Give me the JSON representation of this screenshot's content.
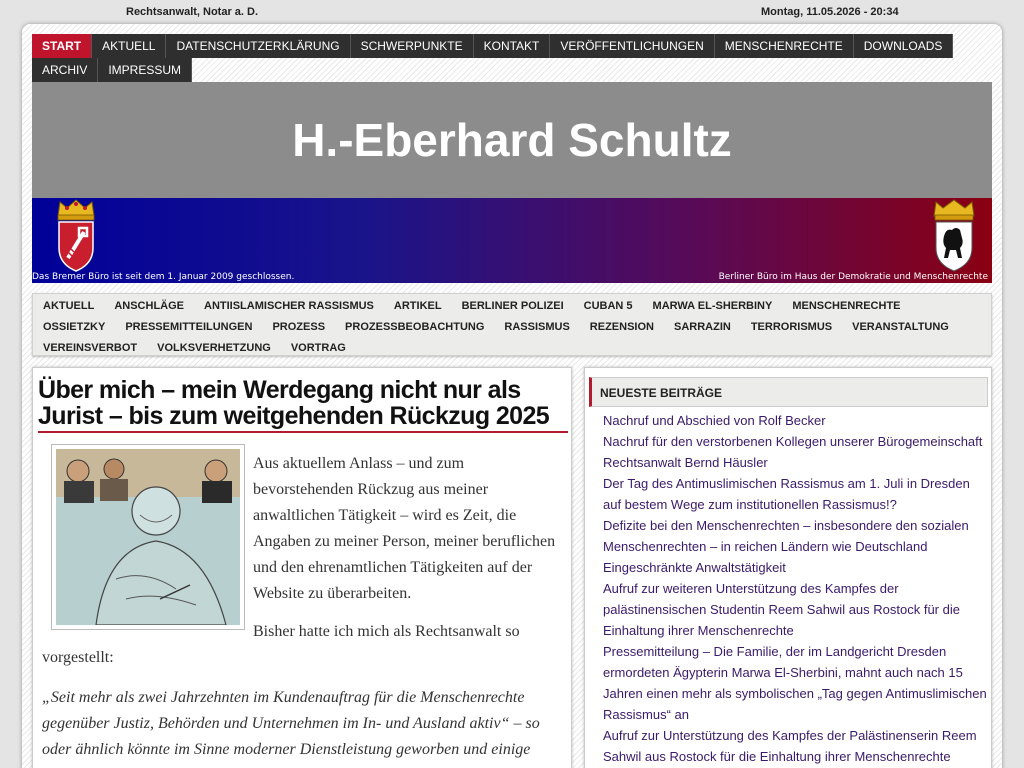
{
  "topbar": {
    "left_text": "Rechtsanwalt, Notar a. D.",
    "right_text": "Montag, 11.05.2026 - 20:34"
  },
  "main_nav": {
    "items": [
      {
        "label": "START",
        "active": true
      },
      {
        "label": "AKTUELL"
      },
      {
        "label": "DATENSCHUTZERKLÄRUNG"
      },
      {
        "label": "SCHWERPUNKTE"
      },
      {
        "label": "KONTAKT"
      },
      {
        "label": "VERÖFFENTLICHUNGEN"
      },
      {
        "label": "MENSCHENRECHTE"
      },
      {
        "label": "DOWNLOADS"
      },
      {
        "label": "ARCHIV"
      },
      {
        "label": "IMPRESSUM"
      }
    ]
  },
  "header": {
    "title": "H.-Eberhard Schultz"
  },
  "banner": {
    "left_caption": "Das Bremer Büro ist seit dem 1. Januar 2009 geschlossen.",
    "right_caption": "Berliner Büro im Haus der Demokratie und Menschenrechte",
    "left_icon": "bremen-crest-icon",
    "right_icon": "berlin-crest-icon"
  },
  "category_nav": {
    "items": [
      "AKTUELL",
      "ANSCHLÄGE",
      "ANTIISLAMISCHER RASSISMUS",
      "ARTIKEL",
      "BERLINER POLIZEI",
      "CUBAN 5",
      "MARWA EL-SHERBINY",
      "MENSCHENRECHTE",
      "OSSIETZKY",
      "PRESSEMITTEILUNGEN",
      "PROZESS",
      "PROZESSBEOBACHTUNG",
      "RASSISMUS",
      "REZENSION",
      "SARRAZIN",
      "TERRORISMUS",
      "VERANSTALTUNG",
      "VEREINSVERBOT",
      "VOLKSVERHETZUNG",
      "VORTRAG"
    ]
  },
  "article": {
    "title": "Über mich – mein Werdegang nicht nur als Jurist – bis zum weitgehenden Rückzug 2025",
    "paragraph1": "Aus aktuellem Anlass – und zum bevorstehenden Rückzug aus meiner anwaltlichen Tätigkeit – wird es Zeit, die Angaben zu meiner Person, meiner beruflichen und den ehrenamtlichen Tätigkeiten auf der Website zu überarbeiten.",
    "paragraph2": "Bisher hatte ich mich als Rechtsanwalt so vorgestellt:",
    "quote": "„Seit mehr als zwei Jahrzehnten im Kundenauftrag für die Menschenrechte gegenüber Justiz, Behörden und Unternehmen im In- und Ausland aktiv“ – so oder ähnlich könnte im Sinne moderner Dienstleistung geworben und einige"
  },
  "sidebar": {
    "widget_title": "NEUESTE BEITRÄGE",
    "posts": [
      "Nachruf und Abschied von Rolf Becker",
      "Nachruf für den verstorbenen Kollegen unserer Bürogemeinschaft Rechtsanwalt Bernd Häusler",
      "Der Tag des Antimuslimischen Rassismus am 1. Juli in Dresden auf bestem Wege zum institutionellen Rassismus!?",
      "Defizite bei den Menschenrechten – insbesondere den sozialen Menschenrechten – in reichen Ländern wie Deutschland",
      "Eingeschränkte Anwaltstätigkeit",
      "Aufruf zur weiteren Unterstützung des Kampfes der palästinensischen Studentin Reem Sahwil aus Rostock für die Einhaltung ihrer Menschenrechte",
      "Pressemitteilung – Die Familie, der im Landgericht Dresden ermordeten Ägypterin Marwa El-Sherbini, mahnt auch nach 15 Jahren einen mehr als symbolischen „Tag gegen Antimuslimischen Rassismus“ an",
      "Aufruf zur Unterstützung des Kampfes der Palästinenserin Reem Sahwil aus Rostock für die Einhaltung ihrer Menschenrechte"
    ]
  },
  "colors": {
    "accent": "#c0142d",
    "nav_bg": "#2f2f2f",
    "header_bg": "#8c8c8c",
    "link": "#3a1a6a"
  }
}
